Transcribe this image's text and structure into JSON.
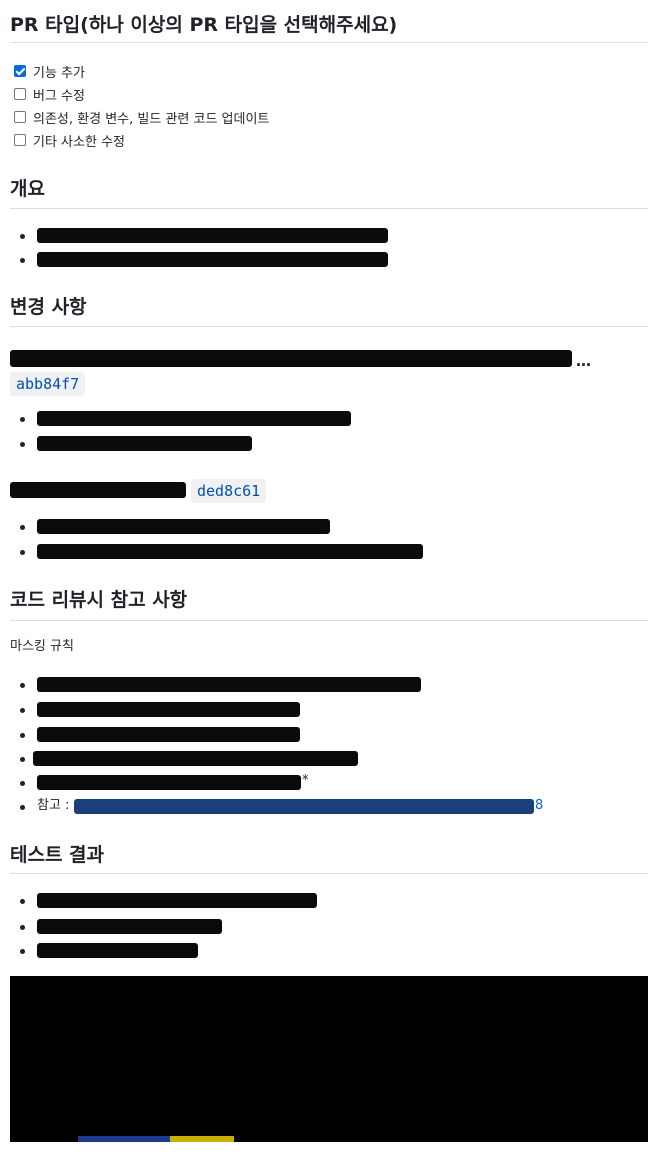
{
  "sections": {
    "pr_type": {
      "title": "PR 타입(하나 이상의 PR 타입을 선택해주세요)",
      "options": [
        {
          "label": "기능 추가",
          "checked": true
        },
        {
          "label": "버그 수정",
          "checked": false
        },
        {
          "label": "의존성, 환경 변수, 빌드 관련 코드 업데이트",
          "checked": false
        },
        {
          "label": "기타 사소한 수정",
          "checked": false
        }
      ]
    },
    "overview": {
      "title": "개요"
    },
    "changes": {
      "title": "변경 사항",
      "commits": [
        {
          "hash": "abb84f7",
          "trailing": "…"
        },
        {
          "hash": "ded8c61"
        }
      ]
    },
    "review_notes": {
      "title": "코드 리뷰시 참고 사항",
      "intro": "마스킹 규칙",
      "asterisk": "*",
      "reference_label": "참고 :",
      "reference_link_tail": "8"
    },
    "test_results": {
      "title": "테스트 결과"
    }
  },
  "colors": {
    "accent": "#0969da",
    "redaction": "#0b0b0b",
    "terminal": "#000000"
  }
}
